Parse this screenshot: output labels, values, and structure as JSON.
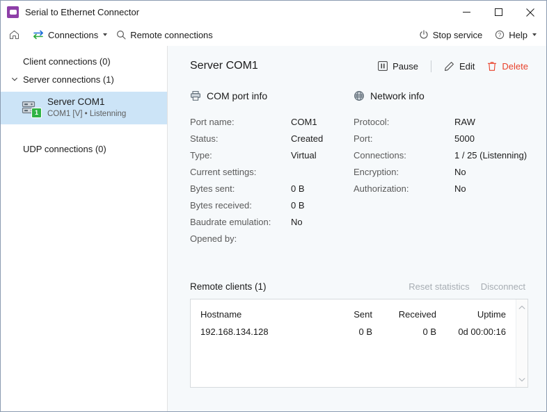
{
  "window": {
    "title": "Serial to Ethernet Connector",
    "icon": "app-icon",
    "minimize": "minimize-button",
    "maximize": "maximize-button",
    "close": "close-button"
  },
  "toolbar": {
    "home_icon": "home-icon",
    "connections_label": "Connections",
    "connections_icon": "transfer-arrows-icon",
    "remote_connections_label": "Remote connections",
    "search_icon": "search-icon",
    "stop_service_label": "Stop service",
    "power_icon": "power-icon",
    "help_label": "Help",
    "help_icon": "question-circle-icon"
  },
  "sidebar": {
    "client_connections": "Client connections (0)",
    "server_connections": "Server connections (1)",
    "udp_connections": "UDP connections (0)",
    "selected_node": {
      "name": "Server COM1",
      "subtitle": "COM1 [V] • Listenning",
      "badge": "1",
      "icon": "server-stack-icon"
    }
  },
  "main": {
    "title": "Server COM1",
    "actions": {
      "pause": "Pause",
      "edit": "Edit",
      "delete": "Delete"
    },
    "com_port_info": {
      "heading": "COM port info",
      "icon": "com-port-icon",
      "rows": [
        {
          "label": "Port name:",
          "value": "COM1"
        },
        {
          "label": "Status:",
          "value": "Created"
        },
        {
          "label": "Type:",
          "value": "Virtual"
        },
        {
          "label": "Current settings:",
          "value": ""
        },
        {
          "label": "Bytes sent:",
          "value": "0 B"
        },
        {
          "label": "Bytes received:",
          "value": "0 B"
        },
        {
          "label": "Baudrate emulation:",
          "value": "No"
        },
        {
          "label": "Opened by:",
          "value": ""
        }
      ]
    },
    "network_info": {
      "heading": "Network info",
      "icon": "globe-icon",
      "rows": [
        {
          "label": "Protocol:",
          "value": "RAW"
        },
        {
          "label": "Port:",
          "value": "5000"
        },
        {
          "label": "Connections:",
          "value": "1 / 25 (Listenning)"
        },
        {
          "label": "Encryption:",
          "value": "No"
        },
        {
          "label": "Authorization:",
          "value": "No"
        }
      ]
    },
    "remote_clients": {
      "title": "Remote clients (1)",
      "reset_statistics": "Reset statistics",
      "disconnect": "Disconnect",
      "columns": [
        "Hostname",
        "Sent",
        "Received",
        "Uptime"
      ],
      "rows": [
        {
          "hostname": "192.168.134.128",
          "sent": "0 B",
          "received": "0 B",
          "uptime": "0d 00:00:16"
        }
      ]
    }
  },
  "colors": {
    "accent_purple": "#8e3fa8",
    "selection_blue": "#cce4f7",
    "delete_red": "#e8412a",
    "badge_green": "#2fb344",
    "panel_bg": "#f6f9fb"
  }
}
